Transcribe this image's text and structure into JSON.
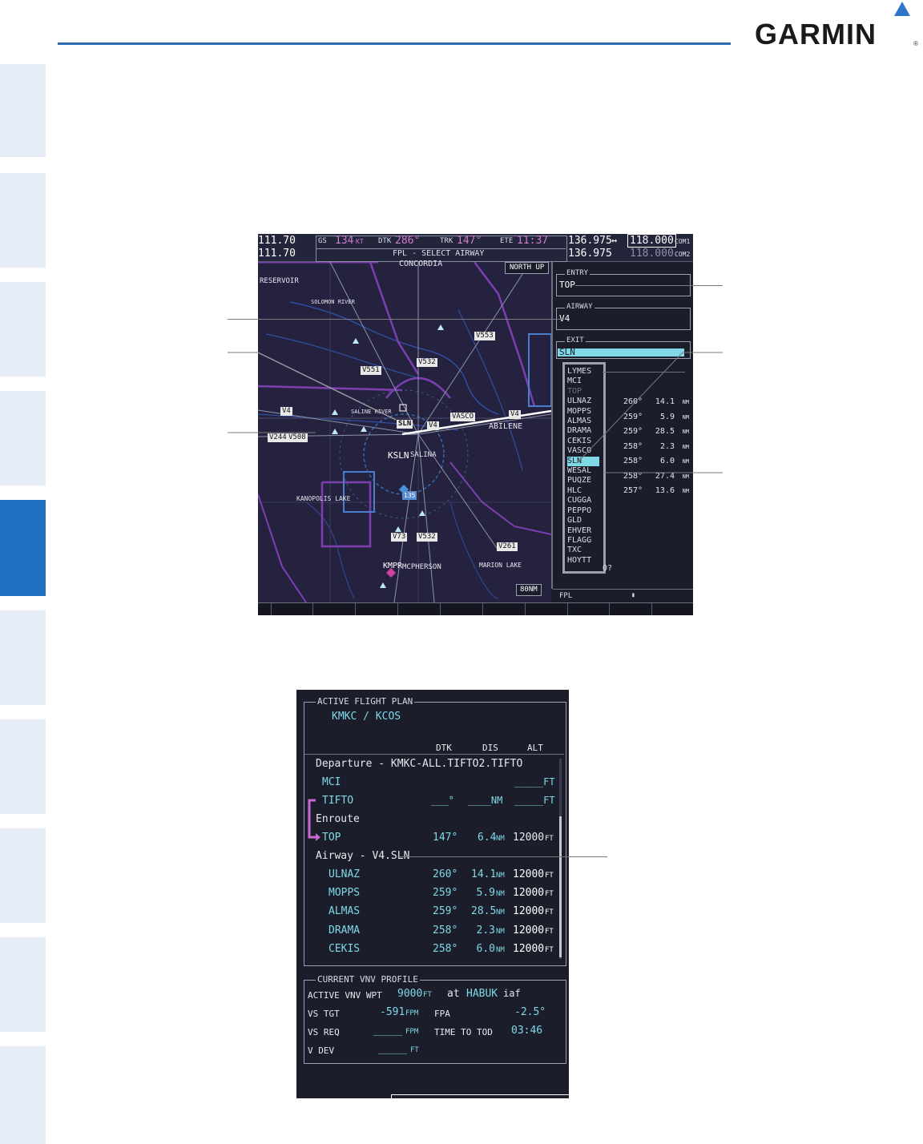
{
  "brand": {
    "name": "GARMIN",
    "registered": "®"
  },
  "screen1": {
    "top_left_freqs": [
      "111.70",
      "111.70"
    ],
    "gs": {
      "label": "GS",
      "value": "134",
      "unit": "KT"
    },
    "dtk": {
      "label": "DTK",
      "value": "286°"
    },
    "trk": {
      "label": "TRK",
      "value": "147°"
    },
    "ete": {
      "label": "ETE",
      "value": "11:37"
    },
    "title": "FPL - SELECT AIRWAY",
    "com": {
      "active1": "136.975",
      "arrow": "↔",
      "standby1": "118.000",
      "label1": "COM1",
      "active2": "136.975",
      "standby2": "118.000",
      "label2": "COM2"
    },
    "north_up": "NORTH UP",
    "range": "80NM",
    "map_labels": {
      "concordia": "CONCORDIA",
      "reservoir": "RESERVOIR",
      "solomon": "SOLOMON RIVER",
      "saline": "SALINE RIVER",
      "v551": "V551",
      "v532a": "V532",
      "v553": "V553",
      "v4a": "V4",
      "v4b": "V4",
      "v4c": "V4",
      "v244": "V244",
      "v508": "V508",
      "sln": "SLN",
      "vasco": "VASCO",
      "abilene": "ABILENE",
      "ksln": "KSLN",
      "salina": "SALINA",
      "kanopolis": "KANOPOLIS LAKE",
      "i135": "135",
      "v73": "V73",
      "v532b": "V532",
      "v261": "V261",
      "kmpr": "KMPR",
      "mcpherson": "MCPHERSON",
      "marion": "MARION LAKE"
    },
    "entry": {
      "label": "ENTRY",
      "value": "TOP"
    },
    "airway": {
      "label": "AIRWAY",
      "value": "V4"
    },
    "exit": {
      "label": "EXIT",
      "value": "SLN"
    },
    "exit_list": [
      "LYMES",
      "MCI",
      "TOP",
      "ULNAZ",
      "MOPPS",
      "ALMAS",
      "DRAMA",
      "CEKIS",
      "VASCO",
      "SLN",
      "WESAL",
      "PUQZE",
      "HLC",
      "CUGGA",
      "PEPPO",
      "GLD",
      "EHVER",
      "FLAGG",
      "TXC",
      "HOYTT"
    ],
    "exit_selected": "SLN",
    "exit_dim": "TOP",
    "legs": [
      {
        "dtk": "260°",
        "dis": "14.1",
        "unit": "NM"
      },
      {
        "dtk": "259°",
        "dis": "5.9",
        "unit": "NM"
      },
      {
        "dtk": "259°",
        "dis": "28.5",
        "unit": "NM"
      },
      {
        "dtk": "258°",
        "dis": "2.3",
        "unit": "NM"
      },
      {
        "dtk": "258°",
        "dis": "6.0",
        "unit": "NM"
      },
      {
        "dtk": "258°",
        "dis": "27.4",
        "unit": "NM"
      },
      {
        "dtk": "257°",
        "dis": "13.6",
        "unit": "NM"
      }
    ],
    "bottom_q": "O?",
    "fpl_label": "FPL",
    "fpl_marker": "▮"
  },
  "screen2": {
    "active_fp_label": "ACTIVE FLIGHT PLAN",
    "route": "KMKC / KCOS",
    "headers": {
      "dtk": "DTK",
      "dis": "DIS",
      "alt": "ALT"
    },
    "departure": "Departure - KMKC-ALL.TIFTO2.TIFTO",
    "mci": {
      "name": "MCI",
      "alt": "_____FT"
    },
    "tifto": {
      "name": "TIFTO",
      "dtk": "___°",
      "dis": "____NM",
      "alt": "_____FT"
    },
    "enroute": "Enroute",
    "top": {
      "name": "TOP",
      "dtk": "147°",
      "dis": "6.4",
      "dis_unit": "NM",
      "alt": "12000",
      "alt_unit": "FT"
    },
    "airway": "Airway - V4.SLN",
    "airway_legs": [
      {
        "name": "ULNAZ",
        "dtk": "260°",
        "dis": "14.1",
        "alt": "12000"
      },
      {
        "name": "MOPPS",
        "dtk": "259°",
        "dis": "5.9",
        "alt": "12000"
      },
      {
        "name": "ALMAS",
        "dtk": "259°",
        "dis": "28.5",
        "alt": "12000"
      },
      {
        "name": "DRAMA",
        "dtk": "258°",
        "dis": "2.3",
        "alt": "12000"
      },
      {
        "name": "CEKIS",
        "dtk": "258°",
        "dis": "6.0",
        "alt": "12000"
      }
    ],
    "units": {
      "nm": "NM",
      "ft": "FT"
    },
    "vnv_label": "CURRENT VNV PROFILE",
    "vnv": {
      "active_wpt_label": "ACTIVE VNV WPT",
      "active_wpt_alt": "9000",
      "ft": "FT",
      "at": "at",
      "wpt": "HABUK",
      "wpt_suffix": "iaf",
      "vs_tgt_label": "VS TGT",
      "vs_tgt": "-591",
      "fpm": "FPM",
      "fpa_label": "FPA",
      "fpa": "-2.5°",
      "vs_req_label": "VS REQ",
      "vs_req": "_____",
      "tod_label": "TIME TO TOD",
      "tod": "03:46",
      "vdev_label": "V DEV",
      "vdev": "_____"
    }
  }
}
